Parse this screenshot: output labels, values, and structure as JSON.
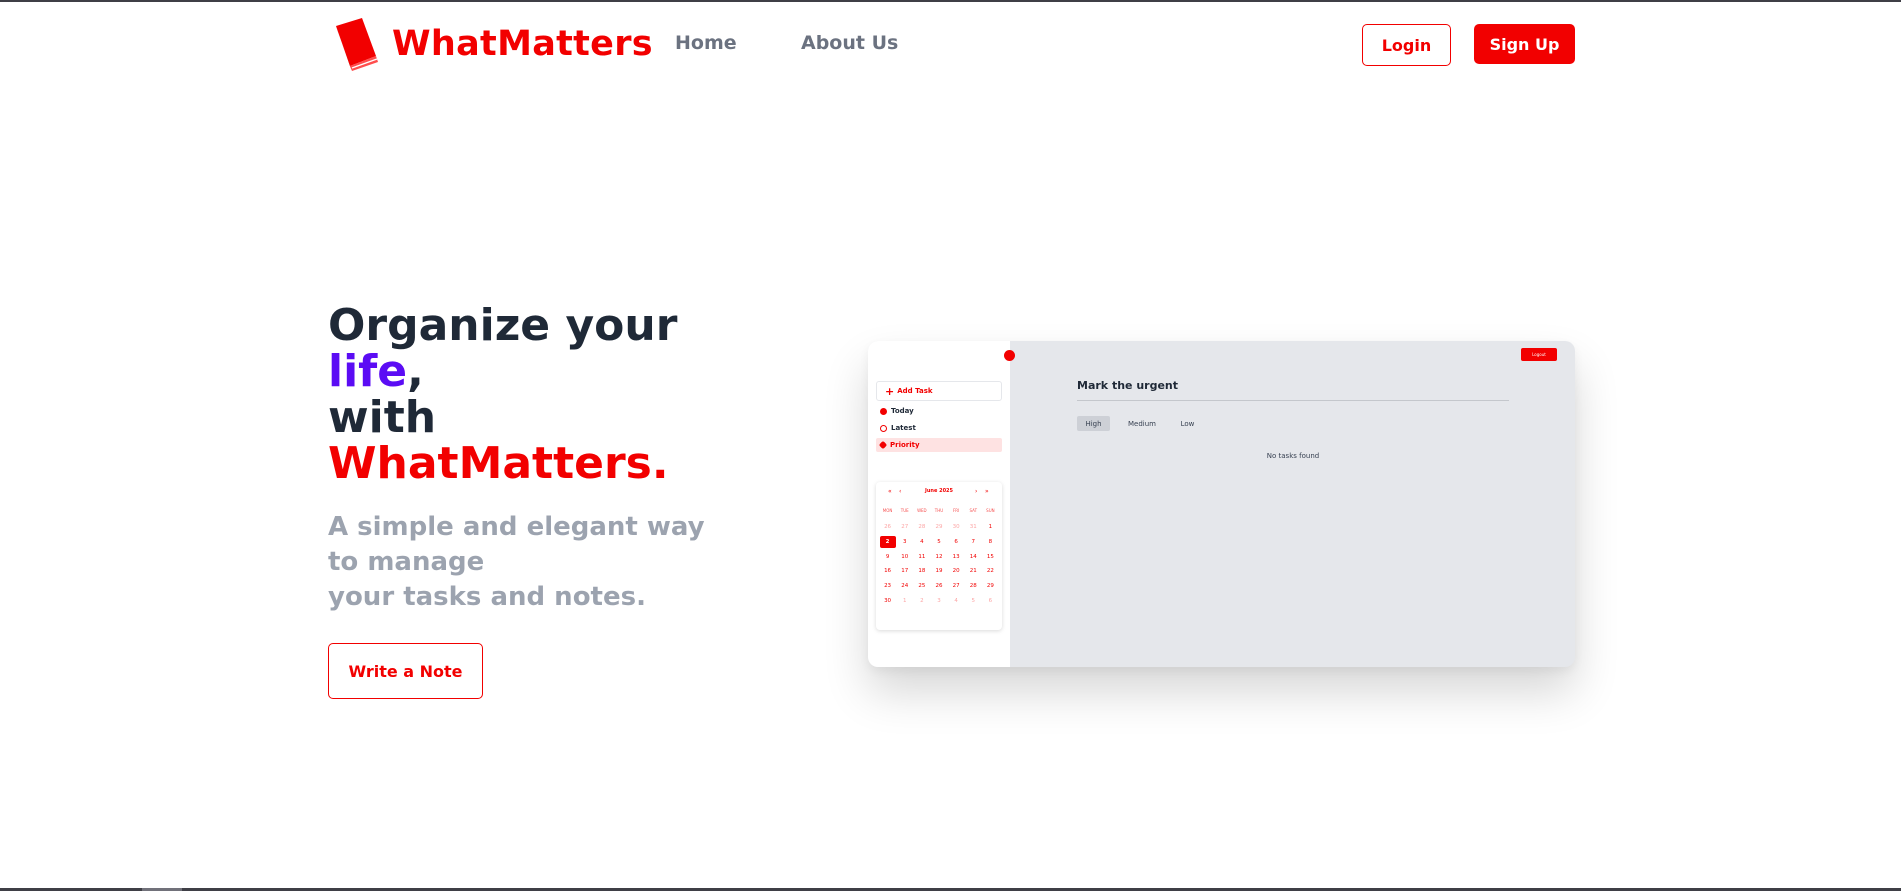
{
  "header": {
    "brand": "WhatMatters",
    "nav": [
      "Home",
      "About Us"
    ],
    "login_label": "Login",
    "signup_label": "Sign Up"
  },
  "hero": {
    "line1": "Organize your",
    "line2_highlight": "life",
    "line2_suffix": ",",
    "line3": "with",
    "line4": "WhatMatters.",
    "subtitle_1": "A simple and elegant way",
    "subtitle_2": "to manage",
    "subtitle_3": "your tasks and notes.",
    "cta_label": "Write a Note"
  },
  "preview": {
    "add_task": "Add Task",
    "nav": [
      "Today",
      "Latest",
      "Priority"
    ],
    "active_nav": "Priority",
    "logout": "Logout",
    "calendar": {
      "month": "June 2025",
      "weekdays": [
        "MON",
        "TUE",
        "WED",
        "THU",
        "FRI",
        "SAT",
        "SUN"
      ],
      "days": [
        {
          "d": "26",
          "muted": true
        },
        {
          "d": "27",
          "muted": true
        },
        {
          "d": "28",
          "muted": true
        },
        {
          "d": "29",
          "muted": true
        },
        {
          "d": "30",
          "muted": true
        },
        {
          "d": "31",
          "muted": true
        },
        {
          "d": "1",
          "muted": false
        },
        {
          "d": "2",
          "muted": false,
          "selected": true
        },
        {
          "d": "3",
          "muted": false
        },
        {
          "d": "4",
          "muted": false
        },
        {
          "d": "5",
          "muted": false
        },
        {
          "d": "6",
          "muted": false
        },
        {
          "d": "7",
          "muted": false
        },
        {
          "d": "8",
          "muted": false
        },
        {
          "d": "9",
          "muted": false
        },
        {
          "d": "10",
          "muted": false
        },
        {
          "d": "11",
          "muted": false
        },
        {
          "d": "12",
          "muted": false
        },
        {
          "d": "13",
          "muted": false
        },
        {
          "d": "14",
          "muted": false
        },
        {
          "d": "15",
          "muted": false
        },
        {
          "d": "16",
          "muted": false
        },
        {
          "d": "17",
          "muted": false
        },
        {
          "d": "18",
          "muted": false
        },
        {
          "d": "19",
          "muted": false
        },
        {
          "d": "20",
          "muted": false
        },
        {
          "d": "21",
          "muted": false
        },
        {
          "d": "22",
          "muted": false
        },
        {
          "d": "23",
          "muted": false
        },
        {
          "d": "24",
          "muted": false
        },
        {
          "d": "25",
          "muted": false
        },
        {
          "d": "26",
          "muted": false
        },
        {
          "d": "27",
          "muted": false
        },
        {
          "d": "28",
          "muted": false
        },
        {
          "d": "29",
          "muted": false
        },
        {
          "d": "30",
          "muted": false
        },
        {
          "d": "1",
          "muted": true
        },
        {
          "d": "2",
          "muted": true
        },
        {
          "d": "3",
          "muted": true
        },
        {
          "d": "4",
          "muted": true
        },
        {
          "d": "5",
          "muted": true
        },
        {
          "d": "6",
          "muted": true
        }
      ]
    },
    "title": "Mark the urgent",
    "tabs": [
      "High",
      "Medium",
      "Low"
    ],
    "active_tab": "High",
    "empty_text": "No tasks found"
  },
  "colors": {
    "brand_red": "#f20000",
    "accent_purple": "#5b0cf4",
    "heading": "#1f2937",
    "muted_text": "#9ca3af"
  },
  "icons": [
    "book-logo-icon",
    "plus-icon",
    "today-icon",
    "clock-icon",
    "priority-tag-icon",
    "chevron-left-icon",
    "chevron-right-icon"
  ]
}
